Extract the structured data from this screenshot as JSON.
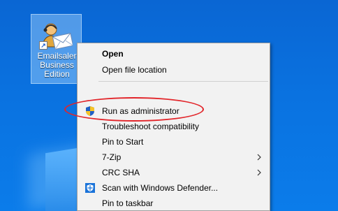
{
  "desktop": {
    "icon": {
      "label": "Emailsaler Business Edition",
      "icon_name": "emailsaler-app-icon",
      "shortcut_overlay": "shortcut-arrow-icon"
    },
    "background_color": "#0a6fdd"
  },
  "context_menu": {
    "items": [
      {
        "label": "Open",
        "bold": true
      },
      {
        "label": "Open file location"
      },
      {
        "separator": true
      },
      {
        "label": "Run as administrator",
        "icon": "uac-shield-icon"
      },
      {
        "label": "Troubleshoot compatibility"
      },
      {
        "label": "Pin to Start"
      },
      {
        "label": "7-Zip",
        "submenu": true
      },
      {
        "label": "CRC SHA",
        "submenu": true
      },
      {
        "label": "Scan with Windows Defender...",
        "icon": "windows-defender-icon"
      },
      {
        "label": "Pin to taskbar"
      }
    ],
    "highlight_color": "#e2252a"
  }
}
